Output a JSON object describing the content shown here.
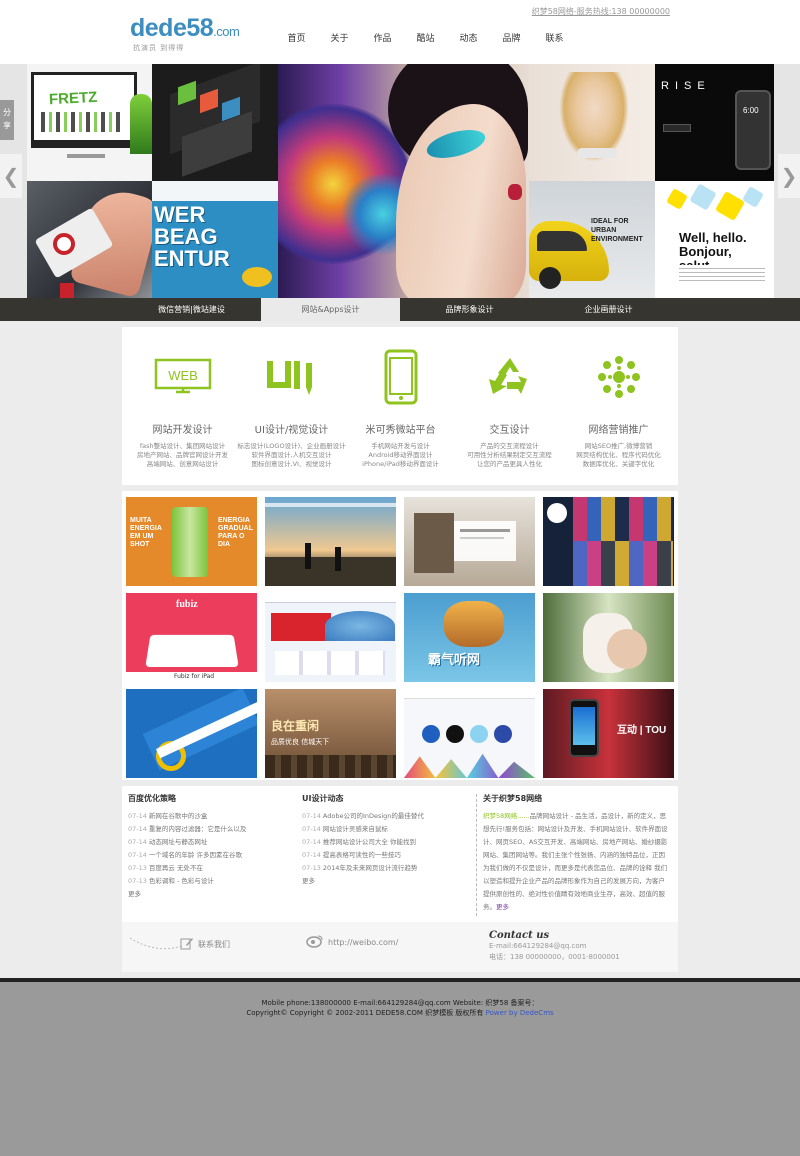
{
  "header": {
    "logo_text": "dede",
    "logo_num": "58",
    "logo_com": ".com",
    "slogan": "抗演员 到得得",
    "hotline": "织梦58网络-服务热线:138 00000000",
    "nav": [
      "首页",
      "关于",
      "作品",
      "酷站",
      "动态",
      "品牌",
      "联系"
    ]
  },
  "banner": {
    "share_label": "分享",
    "prev_icon": "chevron-left-icon",
    "next_icon": "chevron-right-icon",
    "tile_text": {
      "fretz": "FRETZ",
      "wer": "WER",
      "beag": "BEAG",
      "entur": "ENTUR",
      "rise": "RISE",
      "time": "6:00",
      "ideal": "IDEAL FOR URBAN ENVIRONMENT",
      "bonjour": "Well, hello. Bonjour, salut."
    }
  },
  "tabs": [
    "微信营销|微站建设",
    "网站&Apps设计",
    "品牌形象设计",
    "企业画册设计"
  ],
  "services": [
    {
      "icon": "web-icon",
      "title": "网站开发设计",
      "desc": [
        "fash整站设计、集团网站设计",
        "房地产网站、品牌官网设计开发",
        "高端网站、创意网站设计"
      ]
    },
    {
      "icon": "ui-icon",
      "title": "UI设计/视觉设计",
      "desc": [
        "标志设计(LOGO设计)、企业画册设计",
        "软件界面设计,人机交互设计",
        "图标创意设计,VI、视觉设计"
      ]
    },
    {
      "icon": "mobile-icon",
      "title": "米可秀微站平台",
      "desc": [
        "手机网站开发与设计",
        "Android移动界面设计",
        "iPhone/iPad移动界面设计"
      ]
    },
    {
      "icon": "recycle-icon",
      "title": "交互设计",
      "desc": [
        "产品的交互流程设计",
        "可用性分析结果制定交互流程",
        "让您的产品更具人性化"
      ]
    },
    {
      "icon": "network-icon",
      "title": "网络营销推广",
      "desc": [
        "网站SEO推广,微博营销",
        "网页结构优化、程序代码优化",
        "数据库优化、关键字优化"
      ]
    }
  ],
  "portfolio": {
    "muita": "MUITA ENERGIA EM UM SHOT",
    "energia": "ENERGIA GRADUAL PARA O DIA",
    "fubiz": "fubiz",
    "fubiz_caption": "Fubiz for iPad",
    "music": "霸气听网",
    "lianxin": "良在重闲",
    "lianxin2": "品质优良 信城天下",
    "touch": "互动 | TOU"
  },
  "news": {
    "col1": {
      "title": "百度优化策略",
      "items": [
        {
          "date": "07-14",
          "text": "新网在谷歌中的沙盒"
        },
        {
          "date": "07-14",
          "text": "重复的内容过滤器：它是什么以及"
        },
        {
          "date": "07-14",
          "text": "动态网址与静态网址"
        },
        {
          "date": "07-14",
          "text": "一个域名的年龄 许多因素在谷歌"
        },
        {
          "date": "07-13",
          "text": "百度再云 无处不在"
        },
        {
          "date": "07-13",
          "text": "色彩调和 - 色彩与设计"
        }
      ],
      "more": "更多"
    },
    "col2": {
      "title": "UI设计动态",
      "items": [
        {
          "date": "07-14",
          "text": "Adobe公司的InDesign的最佳替代"
        },
        {
          "date": "07-14",
          "text": "网站设计灵感来自鼠标"
        },
        {
          "date": "07-14",
          "text": "推荐网站设计公司大全 你能找到"
        },
        {
          "date": "07-14",
          "text": "提高表格可读性的一些技巧"
        },
        {
          "date": "07-13",
          "text": "2014年及未来网页设计流行趋势"
        }
      ],
      "more": "更多"
    },
    "about": {
      "title": "关于织梦58网络",
      "highlight": "织梦58网络......",
      "body": "品牌网站设计 - 品生活，品设计，新的定义，思想先行!服务包括：网站设计及开发、手机网站设计、软件界面设计、网页SEO、AS交互开发、高端网站、房地产网站、婚纱摄影网站、集团网站等。我们主张个性张扬、内涵的独特品位，正因为我们做的不仅是设计，而更多是代表您品位、品牌的诠释 我们以塑造和提升企业产品的品牌形象作为自己的发展方向，为客户提供原创性的、绝对性价值睛有效地商业生存，高效、超值的服务。",
      "more": "更多"
    }
  },
  "contact": {
    "contact_label": "联系我们",
    "weibo": "http://weibo.com/",
    "title": "Contact us",
    "email": "E-mail:664129284@qq.com",
    "phone": "电话：138 00000000，0001-8000001"
  },
  "footer": {
    "line1": "Mobile phone:138000000  E-mail:664129284@qq.com  Website: 织梦58  备案号：",
    "line2": "Copyright© Copyright © 2002-2011 DEDE58.COM 织梦模板 版权所有 ",
    "powered": "Power by DedeCms"
  },
  "colors": {
    "accent_green": "#8fc31f",
    "brand_blue": "#3c8dc0",
    "dark_bar": "#37352f"
  }
}
